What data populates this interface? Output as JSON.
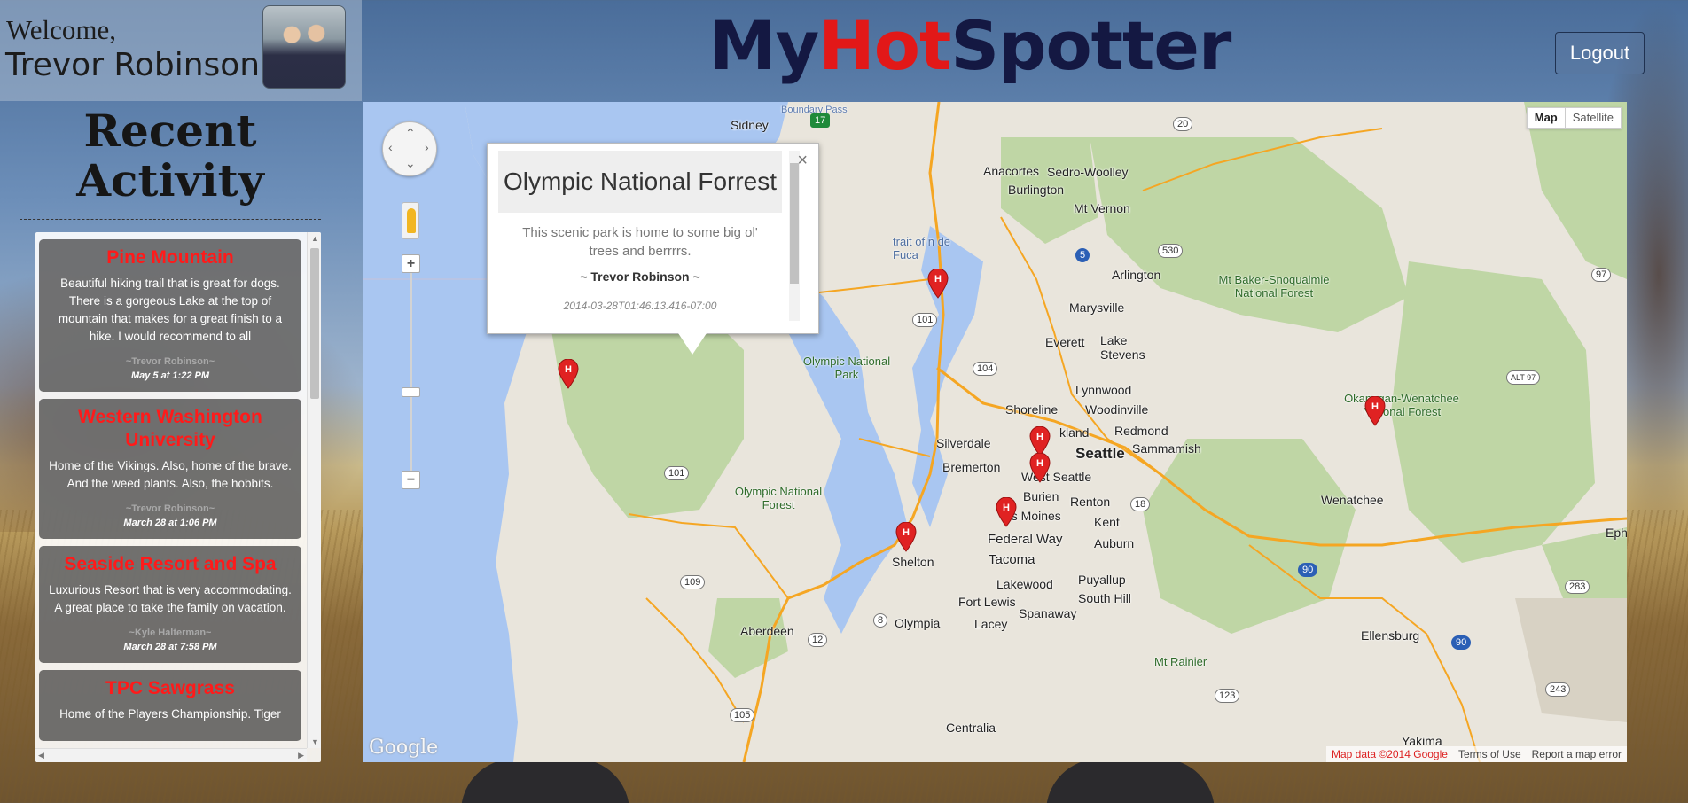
{
  "header": {
    "welcome_label": "Welcome,",
    "user_name": "Trevor Robinson",
    "brand_part1": "My",
    "brand_part2": "Hot",
    "brand_part3": "Spotter",
    "logout_label": "Logout"
  },
  "sidebar": {
    "title_line1": "Recent",
    "title_line2": "Activity",
    "cards": [
      {
        "title": "Pine Mountain",
        "body": "Beautiful hiking trail that is great for dogs. There is a gorgeous Lake at the top of mountain that makes for a great finish to a hike. I would recommend to all",
        "author": "~Trevor Robinson~",
        "date": "May 5 at 1:22 PM"
      },
      {
        "title": "Western Washington University",
        "body": "Home of the Vikings. Also, home of the brave. And the weed plants. Also, the hobbits.",
        "author": "~Trevor Robinson~",
        "date": "March 28 at 1:06 PM"
      },
      {
        "title": "Seaside Resort and Spa",
        "body": "Luxurious Resort that is very accommodating. A great place to take the family on vacation.",
        "author": "~Kyle Halterman~",
        "date": "March 28 at 7:58 PM"
      },
      {
        "title": "TPC Sawgrass",
        "body": "Home of the Players Championship. Tiger",
        "author": "",
        "date": ""
      }
    ]
  },
  "map": {
    "type_map": "Map",
    "type_satellite": "Satellite",
    "google_logo": "Google",
    "map_data": "Map data ©2014 Google",
    "terms": "Terms of Use",
    "report": "Report a map error",
    "labels": {
      "sidney": "Sidney",
      "boundary_pass": "Boundary Pass",
      "anacortes": "Anacortes",
      "sedro_woolley": "Sedro-Woolley",
      "burlington": "Burlington",
      "mt_vernon": "Mt Vernon",
      "strait": "trait of n de Fuca",
      "arlington": "Arlington",
      "mt_baker": "Mt Baker-Snoqualmie National Forest",
      "marysville": "Marysville",
      "everett": "Everett",
      "lake_stevens": "Lake Stevens",
      "olympic_park": "Olympic National Park",
      "lynnwood": "Lynnwood",
      "shoreline": "Shoreline",
      "woodinville": "Woodinville",
      "kirkland": "kland",
      "redmond": "Redmond",
      "sammamish": "Sammamish",
      "seattle": "Seattle",
      "silverdale": "Silverdale",
      "bremerton": "Bremerton",
      "west_seattle": "West Seattle",
      "burien": "Burien",
      "renton": "Renton",
      "des_moines": "es Moines",
      "kent": "Kent",
      "federal_way": "Federal Way",
      "auburn": "Auburn",
      "olympic_forest": "Olympic National Forest",
      "shelton": "Shelton",
      "tacoma": "Tacoma",
      "puyallup": "Puyallup",
      "lakewood": "Lakewood",
      "south_hill": "South Hill",
      "fort_lewis": "Fort Lewis",
      "spanaway": "Spanaway",
      "olympia": "Olympia",
      "lacey": "Lacey",
      "aberdeen": "Aberdeen",
      "mt_rainier": "Mt Rainier",
      "centralia": "Centralia",
      "okanogan": "Okanogan-Wenatchee National Forest",
      "wenatchee": "Wenatchee",
      "ellensburg": "Ellensburg",
      "yakima": "Yakima",
      "eph": "Eph"
    },
    "highways": [
      "17",
      "20",
      "530",
      "5",
      "101",
      "104",
      "97",
      "ALT 97",
      "18",
      "101",
      "109",
      "90",
      "12",
      "8",
      "123",
      "283",
      "90",
      "243",
      "105",
      "12"
    ]
  },
  "infowindow": {
    "title": "Olympic National Forrest",
    "body": "This scenic park is home to some big ol' trees and berrrrs.",
    "author": "~ Trevor Robinson ~",
    "date": "2014-03-28T01:46:13.416-07:00",
    "close": "×"
  },
  "colors": {
    "brand_dark": "#141842",
    "brand_red": "#e21818",
    "card_title": "#ff1a1a",
    "water": "#a9c6f1",
    "land": "#e9e5dc",
    "forest": "#bfd6a5",
    "highway": "#f5a623"
  },
  "icons": {
    "pan": "pan-control-icon",
    "pegman": "pegman-icon",
    "zoom_in": "zoom-in-icon",
    "zoom_out": "zoom-out-icon",
    "marker": "hotspot-marker-icon",
    "close": "close-icon"
  }
}
